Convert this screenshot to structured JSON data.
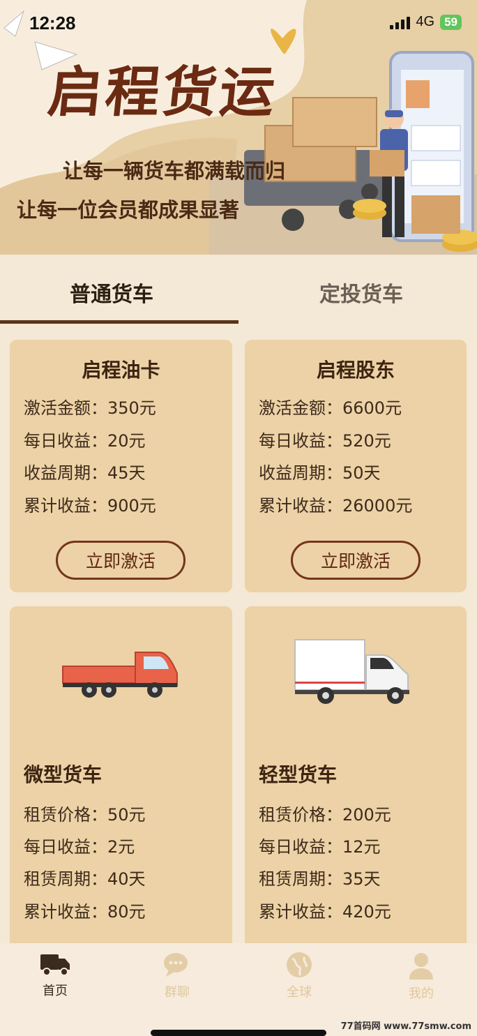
{
  "status": {
    "time": "12:28",
    "network": "4G",
    "battery": "59"
  },
  "banner": {
    "brand": "启程货运",
    "slogan_line1": "让每一辆货车都满载而归",
    "slogan_line2": "让每一位会员都成果显著"
  },
  "tabs": [
    {
      "label": "普通货车",
      "active": true
    },
    {
      "label": "定投货车",
      "active": false
    }
  ],
  "cards": [
    {
      "title": "启程油卡",
      "rows": [
        "激活金额：350元",
        "每日收益：20元",
        "收益周期：45天",
        "累计收益：900元"
      ],
      "button": "立即激活"
    },
    {
      "title": "启程股东",
      "rows": [
        "激活金额：6600元",
        "每日收益：520元",
        "收益周期：50天",
        "累计收益：26000元"
      ],
      "button": "立即激活"
    },
    {
      "title": "微型货车",
      "rows": [
        "租赁价格：50元",
        "每日收益：2元",
        "租赁周期：40天",
        "累计收益：80元"
      ],
      "icon": "red-pickup-truck-image"
    },
    {
      "title": "轻型货车",
      "rows": [
        "租赁价格：200元",
        "每日收益：12元",
        "租赁周期：35天",
        "累计收益：420元"
      ],
      "icon": "white-box-truck-image"
    }
  ],
  "nav": [
    {
      "label": "首页",
      "icon": "truck-icon",
      "active": true
    },
    {
      "label": "群聊",
      "icon": "chat-icon",
      "active": false
    },
    {
      "label": "全球",
      "icon": "globe-icon",
      "active": false
    },
    {
      "label": "我的",
      "icon": "user-icon",
      "active": false
    }
  ],
  "watermark": "77首码网 www.77smw.com",
  "colors": {
    "accent": "#5a3418",
    "card": "#ecd2a6",
    "background": "#f4e8d6",
    "inactive_nav": "#e0c89e"
  }
}
